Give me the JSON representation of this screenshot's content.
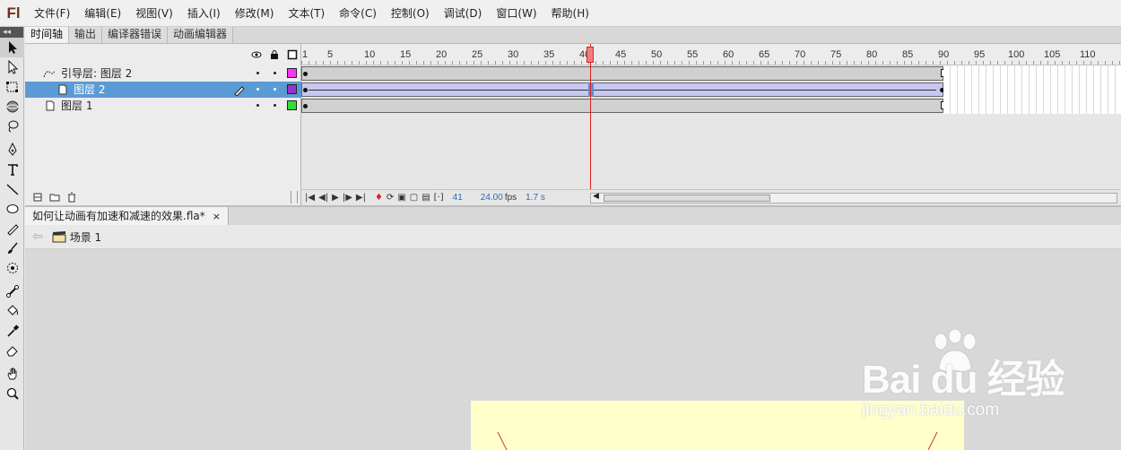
{
  "app": {
    "logo": "Fl"
  },
  "menu": [
    "文件(F)",
    "编辑(E)",
    "视图(V)",
    "插入(I)",
    "修改(M)",
    "文本(T)",
    "命令(C)",
    "控制(O)",
    "调试(D)",
    "窗口(W)",
    "帮助(H)"
  ],
  "panel_tabs": [
    "时间轴",
    "输出",
    "编译器错误",
    "动画编辑器"
  ],
  "toolbar": {
    "collapse": "◂◂"
  },
  "timeline": {
    "ruler": [
      "1",
      "5",
      "10",
      "15",
      "20",
      "25",
      "30",
      "35",
      "40",
      "45",
      "50",
      "55",
      "60",
      "65",
      "70",
      "75",
      "80",
      "85",
      "90",
      "95",
      "100",
      "105",
      "110"
    ],
    "layers": [
      {
        "name": "引导层: 图层 2",
        "color": "#ff33ff",
        "selected": false
      },
      {
        "name": "图层 2",
        "color": "#9933cc",
        "selected": true
      },
      {
        "name": "图层 1",
        "color": "#33dd33",
        "selected": false
      }
    ],
    "current_frame": "41",
    "fps": "24.00",
    "fps_unit": "fps",
    "time": "1.7 s"
  },
  "document": {
    "tab_title": "如何让动画有加速和减速的效果.fla*",
    "tab_close": "×",
    "scene": "场景 1",
    "back_arrow": "⇦"
  },
  "watermark": {
    "main": "Bai du 经验",
    "sub": "jingyan.baidu.com"
  }
}
